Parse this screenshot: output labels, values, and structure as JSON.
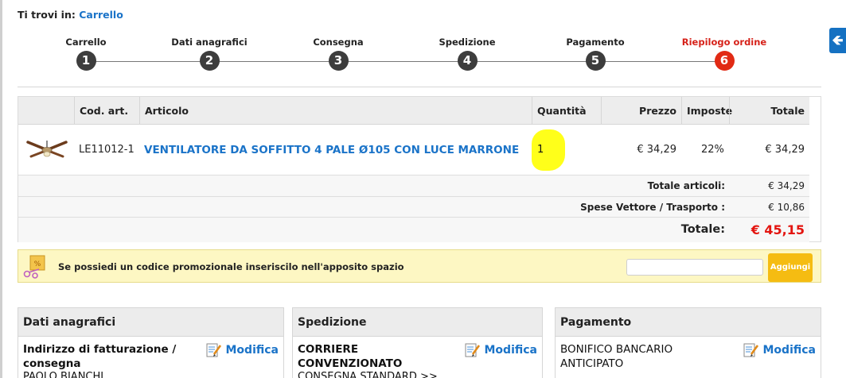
{
  "breadcrumb": {
    "prefix": "Ti trovi in:",
    "link": "Carrello"
  },
  "back_button": {
    "icon": "arrow-left-icon",
    "color": "#1571c2"
  },
  "steps": [
    {
      "label": "Carrello",
      "num": "1",
      "active": false
    },
    {
      "label": "Dati anagrafici",
      "num": "2",
      "active": false
    },
    {
      "label": "Consegna",
      "num": "3",
      "active": false
    },
    {
      "label": "Spedizione",
      "num": "4",
      "active": false
    },
    {
      "label": "Pagamento",
      "num": "5",
      "active": false
    },
    {
      "label": "Riepilogo ordine",
      "num": "6",
      "active": true
    }
  ],
  "table": {
    "headers": {
      "code": "Cod. art.",
      "article": "Articolo",
      "qty": "Quantità",
      "price": "Prezzo",
      "tax": "Imposte",
      "total": "Totale"
    },
    "rows": [
      {
        "image": "ceiling-fan-image",
        "code": "LE11012-1",
        "article": "VENTILATORE DA SOFFITTO 4 PALE Ø105 CON LUCE MARRONE",
        "qty": "1",
        "price": "€ 34,29",
        "tax": "22%",
        "total": "€ 34,29"
      }
    ],
    "summary": {
      "items_label": "Totale articoli:",
      "items_value": "€ 34,29",
      "shipping_label": "Spese Vettore / Trasporto :",
      "shipping_value": "€ 10,86",
      "total_label": "Totale:",
      "total_value": "€ 45,15"
    }
  },
  "promo": {
    "text": "Se possiedi un codice promozionale inseriscilo nell'apposito spazio",
    "input_value": "",
    "button": "Aggiungi",
    "accent": "#f5bc12"
  },
  "sections": {
    "dati": {
      "title": "Dati anagrafici",
      "line1": "Indirizzo di fatturazione /",
      "line2": "consegna",
      "line3": "PAOLO BIANCHI",
      "edit": "Modifica"
    },
    "spedizione": {
      "title": "Spedizione",
      "line1": "CORRIERE",
      "line2": "CONVENZIONATO",
      "line3": "CONSEGNA STANDARD >>",
      "edit": "Modifica"
    },
    "pagamento": {
      "title": "Pagamento",
      "line1": "BONIFICO BANCARIO",
      "line2": "ANTICIPATO",
      "edit": "Modifica"
    }
  },
  "colors": {
    "link": "#1a73c8",
    "active_step": "#e12a14",
    "total": "#e3140f",
    "highlight": "#ffff1a"
  }
}
